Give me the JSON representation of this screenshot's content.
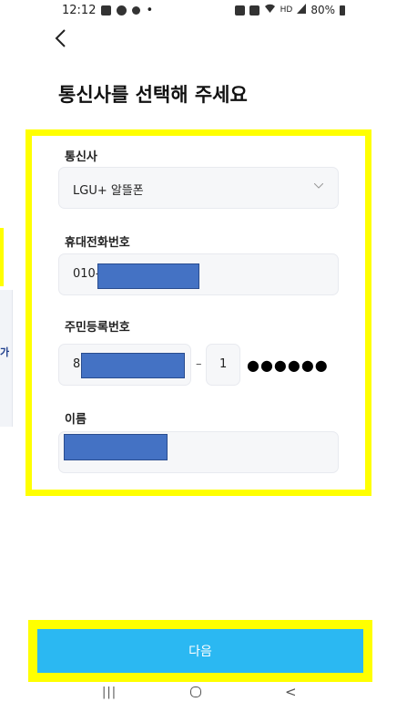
{
  "status_bar": {
    "time": "12:12",
    "extra": "•",
    "signal": "HD",
    "battery": "80%"
  },
  "header": {
    "title": "통신사를 선택해 주세요"
  },
  "side_panel": {
    "text": "가"
  },
  "form": {
    "carrier": {
      "label": "통신사",
      "value": "LGU+ 알뜰폰"
    },
    "phone": {
      "label": "휴대전화번호",
      "prefix": "010-"
    },
    "rrn": {
      "label": "주민등록번호",
      "front_prefix": "8",
      "separator": "–",
      "back_first": "1",
      "mask": "●●●●●●"
    },
    "name": {
      "label": "이름"
    }
  },
  "next_button": {
    "label": "다음"
  },
  "nav_bar": {
    "recent": "|||",
    "back": "<"
  }
}
